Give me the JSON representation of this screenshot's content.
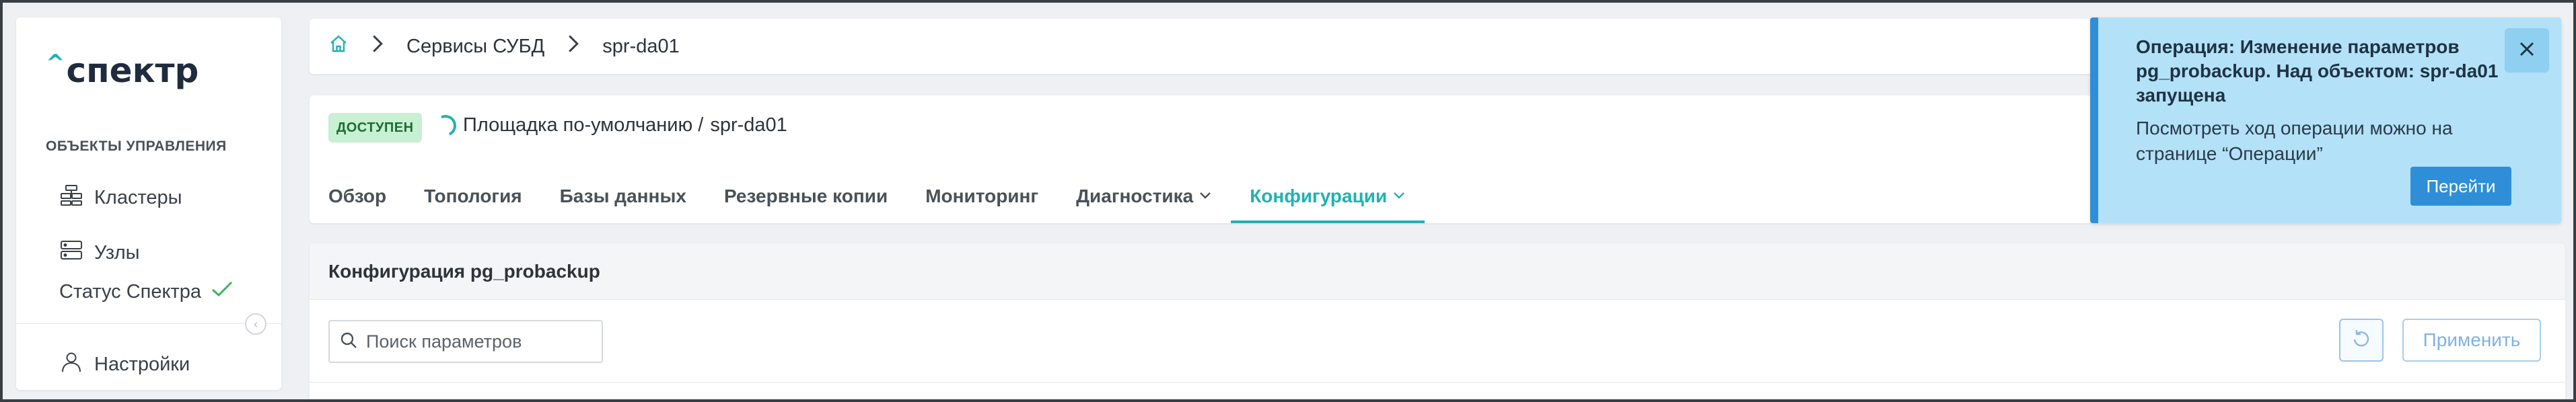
{
  "colors": {
    "accent": "#1fb2b3",
    "primary_button": "#2e8fd8",
    "status_ok": "#3cb35a",
    "badge_bg": "#c8f0d2",
    "toast_bg": "#b3e1f8"
  },
  "sidebar": {
    "logo_text": "спектр",
    "section_label": "ОБЪЕКТЫ УПРАВЛЕНИЯ",
    "items": [
      {
        "label": "Кластеры",
        "icon": "cluster-icon"
      },
      {
        "label": "Узлы",
        "icon": "server-icon"
      }
    ],
    "status_label": "Статус Спектра",
    "status_icon": "checkmark-icon",
    "settings_label": "Настройки",
    "settings_icon": "user-icon",
    "collapse_icon": "chevron-left-icon"
  },
  "breadcrumb": {
    "home_icon": "home-icon",
    "items": [
      "Сервисы СУБД",
      "spr-da01"
    ]
  },
  "header": {
    "badge": "ДОСТУПЕН",
    "platform": "Площадка по-умолчанию /",
    "object": "spr-da01",
    "tabs": [
      {
        "label": "Обзор",
        "dropdown": false,
        "active": false
      },
      {
        "label": "Топология",
        "dropdown": false,
        "active": false
      },
      {
        "label": "Базы данных",
        "dropdown": false,
        "active": false
      },
      {
        "label": "Резервные копии",
        "dropdown": false,
        "active": false
      },
      {
        "label": "Мониторинг",
        "dropdown": false,
        "active": false
      },
      {
        "label": "Диагностика",
        "dropdown": true,
        "active": false
      },
      {
        "label": "Конфигурации",
        "dropdown": true,
        "active": true
      }
    ]
  },
  "config": {
    "title": "Конфигурация pg_probackup",
    "search_placeholder": "Поиск параметров",
    "apply_label": "Применить"
  },
  "toast": {
    "title": "Операция: Изменение параметров pg_probackup. Над объектом: spr-da01 запущена",
    "body": "Посмотреть ход операции можно на странице “Операции”",
    "button_label": "Перейти"
  }
}
